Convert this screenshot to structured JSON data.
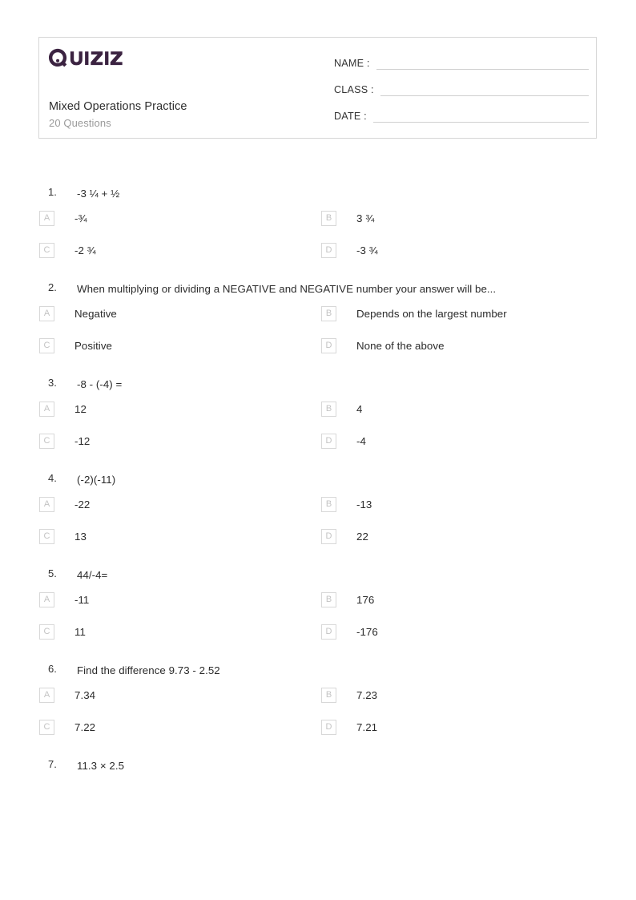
{
  "brand": {
    "name": "Quizizz",
    "logo_color": "#3b2341"
  },
  "header": {
    "title": "Mixed Operations Practice",
    "subtitle": "20 Questions",
    "fields": [
      {
        "label": "NAME :"
      },
      {
        "label": "CLASS :"
      },
      {
        "label": "DATE  :"
      }
    ]
  },
  "questions": [
    {
      "number": "1.",
      "text": "-3 ¼ + ½",
      "options": [
        {
          "letter": "A",
          "text": "-¾"
        },
        {
          "letter": "B",
          "text": "3 ¾"
        },
        {
          "letter": "C",
          "text": "-2 ¾"
        },
        {
          "letter": "D",
          "text": "-3 ¾"
        }
      ]
    },
    {
      "number": "2.",
      "text": "When multiplying or dividing a NEGATIVE and NEGATIVE number your answer will be...",
      "options": [
        {
          "letter": "A",
          "text": "Negative"
        },
        {
          "letter": "B",
          "text": "Depends on the largest number"
        },
        {
          "letter": "C",
          "text": "Positive"
        },
        {
          "letter": "D",
          "text": "None of the above"
        }
      ]
    },
    {
      "number": "3.",
      "text": "-8 - (-4) =",
      "options": [
        {
          "letter": "A",
          "text": "12"
        },
        {
          "letter": "B",
          "text": "4"
        },
        {
          "letter": "C",
          "text": "-12"
        },
        {
          "letter": "D",
          "text": "-4"
        }
      ]
    },
    {
      "number": "4.",
      "text": "(-2)(-11)",
      "options": [
        {
          "letter": "A",
          "text": "-22"
        },
        {
          "letter": "B",
          "text": "-13"
        },
        {
          "letter": "C",
          "text": "13"
        },
        {
          "letter": "D",
          "text": "22"
        }
      ]
    },
    {
      "number": "5.",
      "text": "44/-4=",
      "options": [
        {
          "letter": "A",
          "text": "-11"
        },
        {
          "letter": "B",
          "text": "176"
        },
        {
          "letter": "C",
          "text": "11"
        },
        {
          "letter": "D",
          "text": "-176"
        }
      ]
    },
    {
      "number": "6.",
      "text": "Find the difference 9.73 - 2.52",
      "options": [
        {
          "letter": "A",
          "text": "7.34"
        },
        {
          "letter": "B",
          "text": "7.23"
        },
        {
          "letter": "C",
          "text": "7.22"
        },
        {
          "letter": "D",
          "text": "7.21"
        }
      ]
    },
    {
      "number": "7.",
      "text": "11.3 × 2.5",
      "options": []
    }
  ]
}
